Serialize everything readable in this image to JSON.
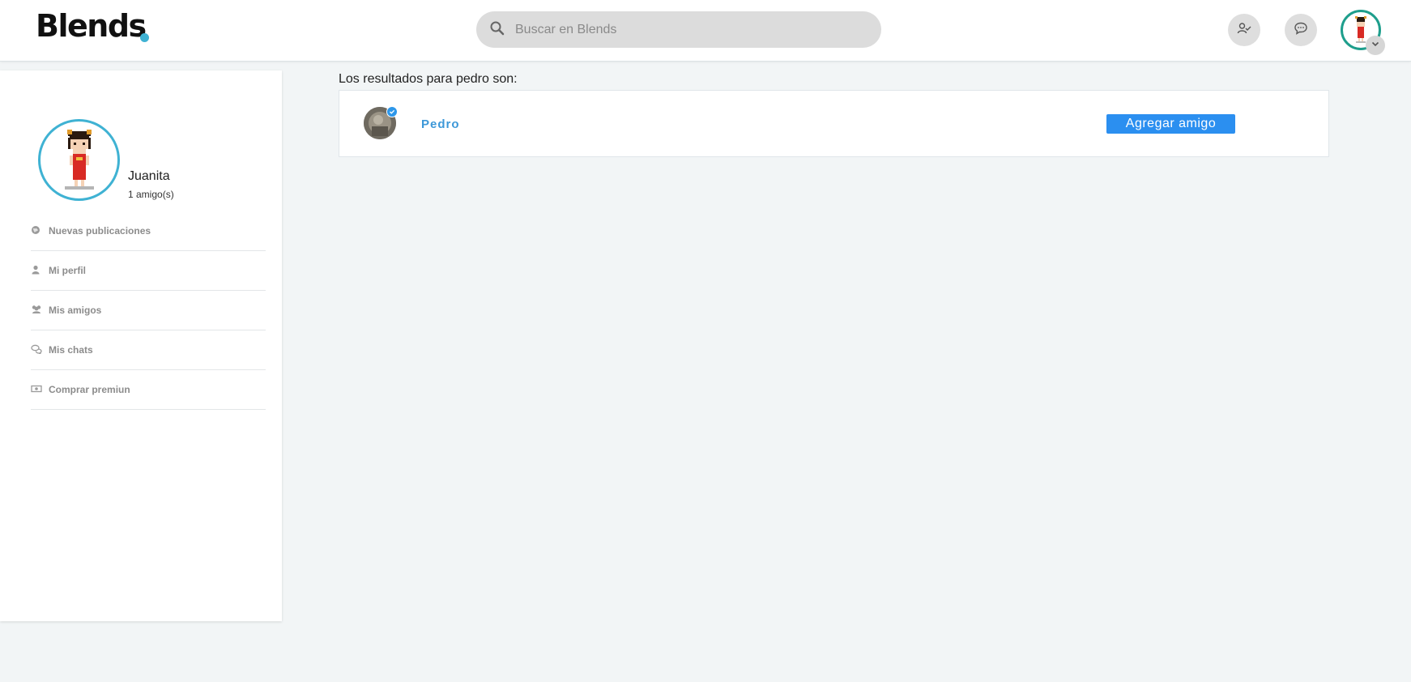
{
  "header": {
    "logo": "Blends",
    "search": {
      "placeholder": "Buscar en Blends",
      "value": ""
    },
    "icons": [
      "friend-requests-icon",
      "messages-icon"
    ],
    "avatar": "juanita-avatar"
  },
  "sidebar": {
    "profile": {
      "name": "Juanita",
      "friends": "1 amigo(s)"
    },
    "items": [
      {
        "label": "Nuevas publicaciones",
        "icon": "globe-icon"
      },
      {
        "label": "Mi perfil",
        "icon": "user-icon"
      },
      {
        "label": "Mis amigos",
        "icon": "users-icon"
      },
      {
        "label": "Mis chats",
        "icon": "chat-icon"
      },
      {
        "label": "Comprar premiun",
        "icon": "money-icon"
      }
    ]
  },
  "results": {
    "title": "Los resultados para pedro son:",
    "items": [
      {
        "name": "Pedro",
        "button": "Agregar amigo",
        "verified": true
      }
    ]
  },
  "colors": {
    "accent": "#3fb2d3",
    "button": "#2b8ff0",
    "link": "#3d98d8",
    "avatar_ring": "#1e9e8c"
  }
}
